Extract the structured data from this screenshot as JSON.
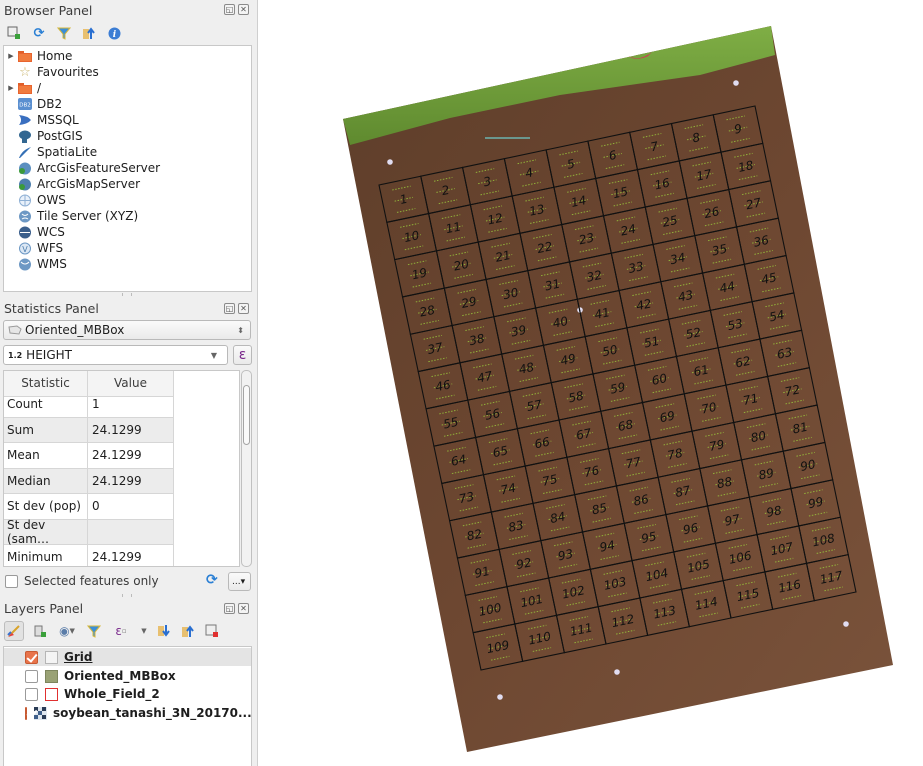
{
  "browser_panel": {
    "title": "Browser Panel",
    "toolbar": [
      {
        "icon": "add-selected-layers-icon"
      },
      {
        "icon": "refresh-icon"
      },
      {
        "icon": "filter-icon"
      },
      {
        "icon": "collapse-all-icon"
      },
      {
        "icon": "info-icon"
      }
    ],
    "items": [
      {
        "label": "Home",
        "icon": "folder-icon",
        "expandable": true
      },
      {
        "label": "Favourites",
        "icon": "star-icon",
        "expandable": false
      },
      {
        "label": "/",
        "icon": "folder-icon",
        "expandable": true
      },
      {
        "label": "DB2",
        "icon": "db2-icon",
        "expandable": false
      },
      {
        "label": "MSSQL",
        "icon": "mssql-icon",
        "expandable": false
      },
      {
        "label": "PostGIS",
        "icon": "postgis-icon",
        "expandable": false
      },
      {
        "label": "SpatiaLite",
        "icon": "spatialite-icon",
        "expandable": false
      },
      {
        "label": "ArcGisFeatureServer",
        "icon": "arcgis-feature-icon",
        "expandable": false
      },
      {
        "label": "ArcGisMapServer",
        "icon": "arcgis-map-icon",
        "expandable": false
      },
      {
        "label": "OWS",
        "icon": "ows-icon",
        "expandable": false
      },
      {
        "label": "Tile Server (XYZ)",
        "icon": "xyz-icon",
        "expandable": false
      },
      {
        "label": "WCS",
        "icon": "wcs-icon",
        "expandable": false
      },
      {
        "label": "WFS",
        "icon": "wfs-icon",
        "expandable": false
      },
      {
        "label": "WMS",
        "icon": "wms-icon",
        "expandable": false
      }
    ]
  },
  "statistics_panel": {
    "title": "Statistics Panel",
    "layer_select": "Oriented_MBBox",
    "field_type": "1.2",
    "field_select": "HEIGHT",
    "expression_button": "ε",
    "columns": [
      "Statistic",
      "Value"
    ],
    "rows": [
      {
        "statistic": "Count",
        "value": "1"
      },
      {
        "statistic": "Sum",
        "value": "24.1299"
      },
      {
        "statistic": "Mean",
        "value": "24.1299"
      },
      {
        "statistic": "Median",
        "value": "24.1299"
      },
      {
        "statistic": "St dev (pop)",
        "value": "0"
      },
      {
        "statistic": "St dev (sam…",
        "value": ""
      },
      {
        "statistic": "Minimum",
        "value": "24.1299"
      }
    ],
    "selected_only_label": "Selected features only",
    "selected_only_checked": false,
    "more_button": "...▾"
  },
  "layers_panel": {
    "title": "Layers Panel",
    "toolbar": [
      {
        "icon": "style-icon"
      },
      {
        "icon": "add-group-icon"
      },
      {
        "icon": "visibility-icon"
      },
      {
        "icon": "filter-icon"
      },
      {
        "icon": "expression-filter-icon"
      },
      {
        "icon": "expand-all-icon"
      },
      {
        "icon": "collapse-all-icon"
      },
      {
        "icon": "remove-layer-icon"
      }
    ],
    "layers": [
      {
        "name": "Grid",
        "checked": true,
        "selected": true,
        "swatch_fill": "#f4f4f4",
        "swatch_stroke": "#b5b5b5"
      },
      {
        "name": "Oriented_MBBox",
        "checked": false,
        "selected": false,
        "swatch_fill": "#9aa275",
        "swatch_stroke": "#7d855d"
      },
      {
        "name": "Whole_Field_2",
        "checked": false,
        "selected": false,
        "swatch_fill": "#ffffff",
        "swatch_stroke": "#e03030"
      },
      {
        "name": "soybean_tanashi_3N_20170...",
        "checked": true,
        "selected": false,
        "swatch_fill": "raster",
        "swatch_stroke": ""
      }
    ]
  },
  "map": {
    "grid": {
      "columns": 9,
      "rows": 13,
      "label_start": 1
    },
    "colors": {
      "soil": "#6b4630",
      "grass": "#6f9a3b",
      "grid_line": "#111111",
      "label": "#111111",
      "plant": "#9ccc3c",
      "marker": "#e0dcf0",
      "flag": "#e0245c",
      "teal_line": "#6cb3ae"
    }
  }
}
